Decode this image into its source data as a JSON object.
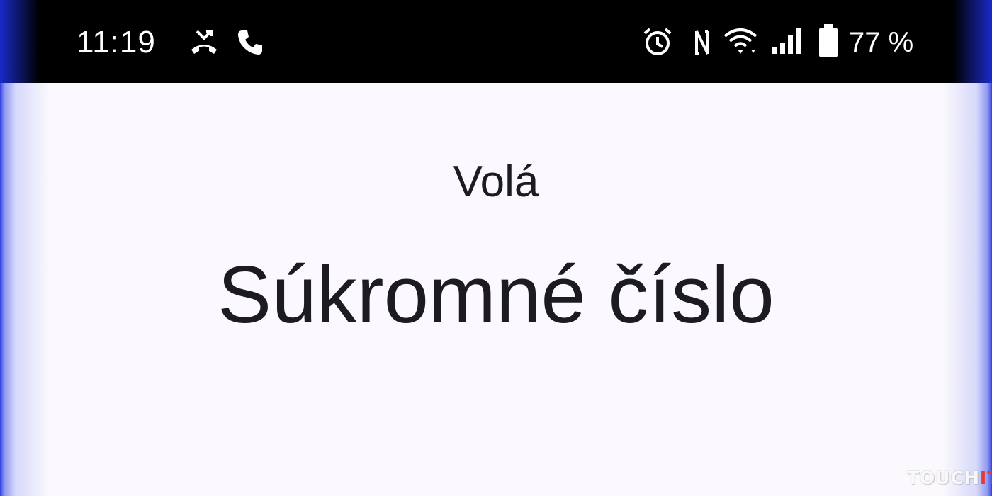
{
  "status_bar": {
    "time": "11:19",
    "battery_percent": "77 %",
    "icons": [
      "missed-call-icon",
      "phone-icon",
      "alarm-icon",
      "nfc-icon",
      "wifi-icon",
      "signal-icon",
      "battery-icon"
    ]
  },
  "call": {
    "label": "Volá",
    "caller": "Súkromné číslo"
  },
  "watermark": {
    "main": "TOUCH",
    "accent": "IT"
  },
  "colors": {
    "status_bar_bg": "#000000",
    "screen_bg": "#fbf9fd",
    "text": "#1c1b1f",
    "edge_glow": "#3040e0",
    "watermark_accent": "#e53935"
  }
}
